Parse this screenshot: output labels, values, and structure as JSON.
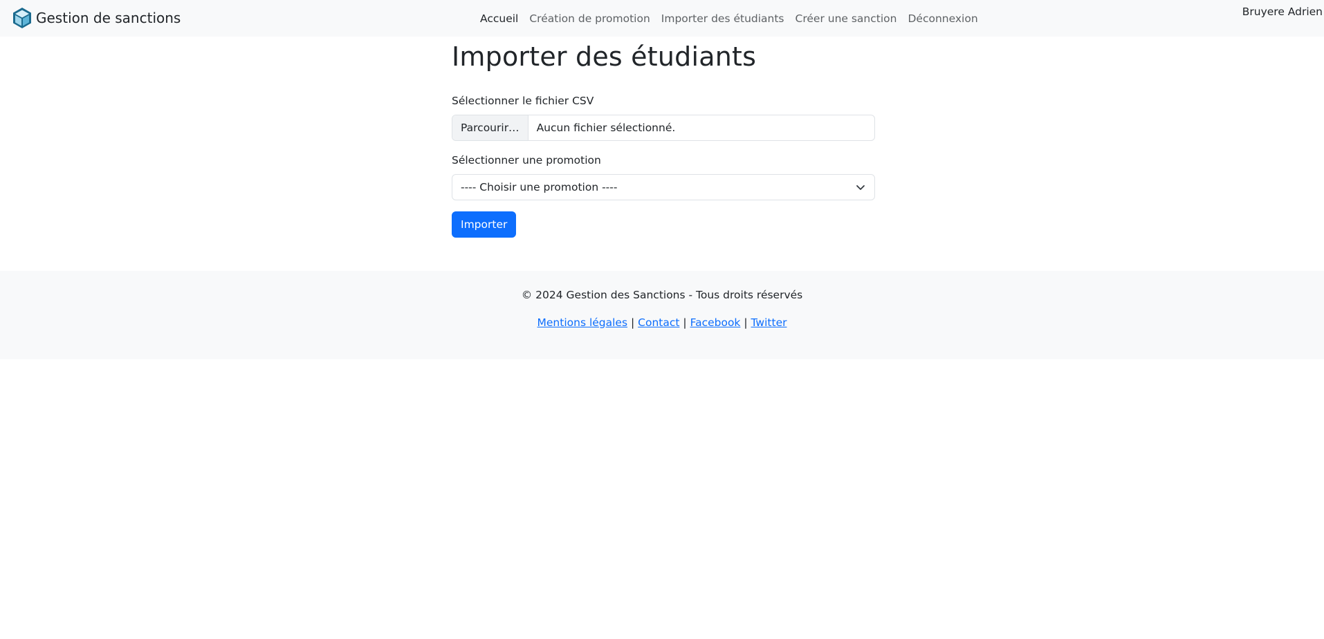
{
  "navbar": {
    "brand": "Gestion de sanctions",
    "brand_icon": "box-icon",
    "links": [
      {
        "label": "Accueil",
        "active": true
      },
      {
        "label": "Création de promotion",
        "active": false
      },
      {
        "label": "Importer des étudiants",
        "active": false
      },
      {
        "label": "Créer une sanction",
        "active": false
      },
      {
        "label": "Déconnexion",
        "active": false
      }
    ],
    "user": "Bruyere Adrien"
  },
  "main": {
    "title": "Importer des étudiants",
    "file_label": "Sélectionner le fichier CSV",
    "file_button": "Parcourir…",
    "file_status": "Aucun fichier sélectionné.",
    "promo_label": "Sélectionner une promotion",
    "promo_selected": "---- Choisir une promotion ----",
    "submit": "Importer"
  },
  "footer": {
    "copyright": "© 2024 Gestion des Sanctions - Tous droits réservés",
    "links": [
      "Mentions légales",
      "Contact",
      "Facebook",
      "Twitter"
    ],
    "separator": "|"
  },
  "colors": {
    "primary": "#0d6efd",
    "navbar_bg": "#f8f9fa",
    "brand_icon": "#1b6b8f"
  }
}
